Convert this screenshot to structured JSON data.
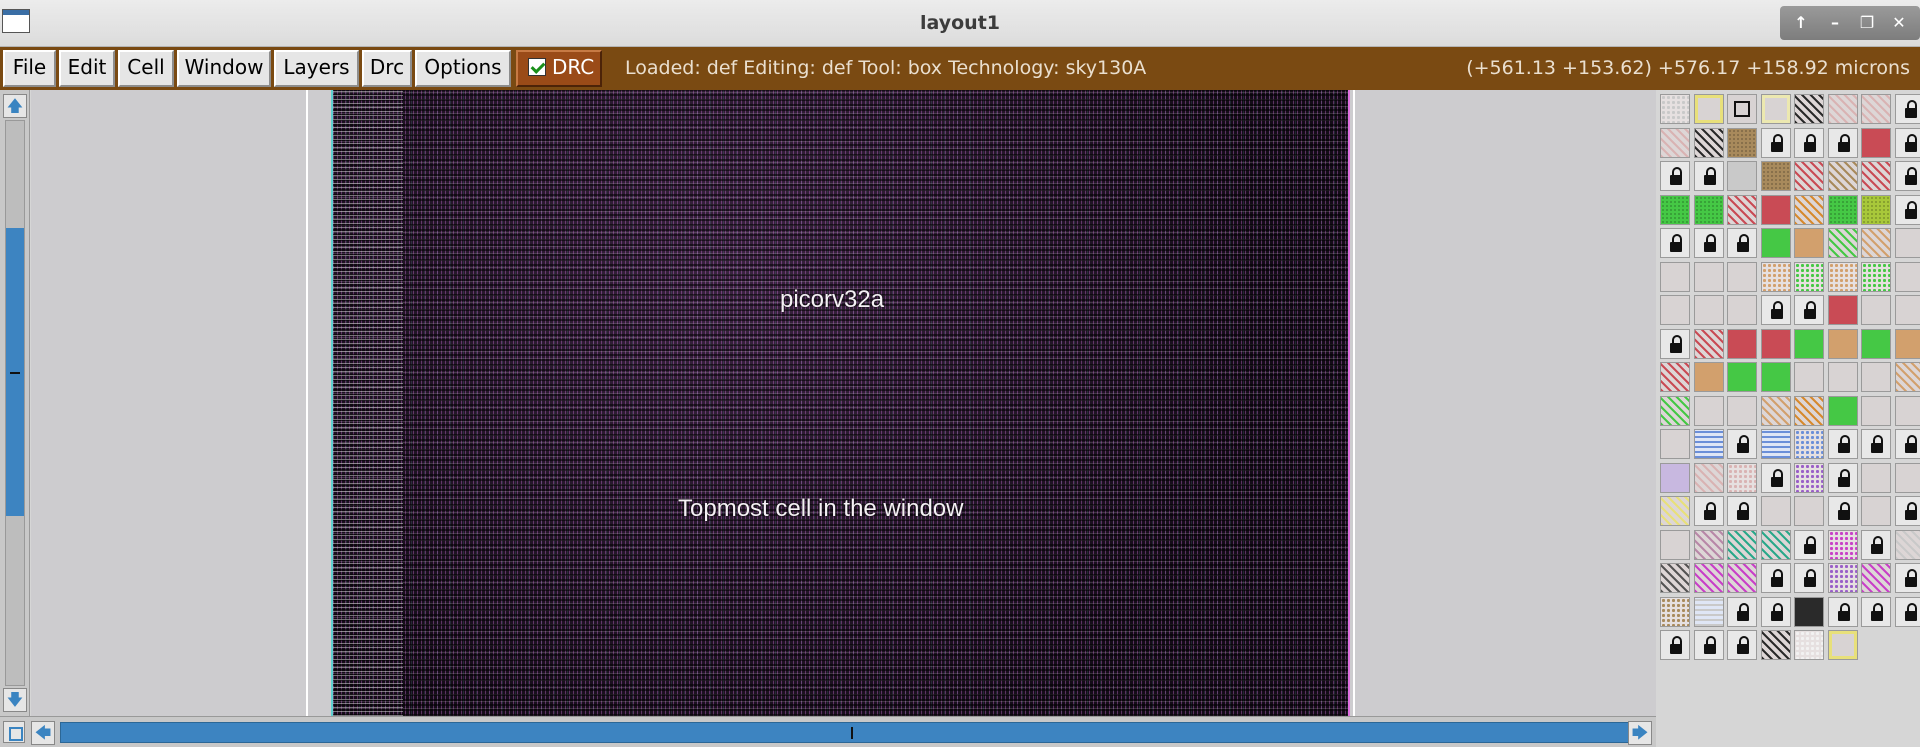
{
  "window": {
    "title": "layout1",
    "controls": {
      "up": "↑",
      "minimize": "–",
      "maximize": "❐",
      "close": "✕"
    }
  },
  "menu": [
    "File",
    "Edit",
    "Cell",
    "Window",
    "Layers",
    "Drc",
    "Options"
  ],
  "drc_toggle": {
    "label": "DRC",
    "checked": true
  },
  "status": {
    "left": "Loaded: def Editing: def Tool: box  Technology: sky130A",
    "right": "(+561.13 +153.62) +576.17 +158.92 microns"
  },
  "canvas": {
    "cell_name": "picorv32a",
    "cell_description": "Topmost cell in the window"
  },
  "scrollbars": {
    "vertical": {
      "thumb_start": 0.19,
      "thumb_end": 0.7,
      "arrow_up": "🡅",
      "arrow_down": "🡇"
    },
    "horizontal": {
      "thumb_start": 0.0,
      "thumb_end": 1.0,
      "arrow_left": "🡄",
      "arrow_right": "🡆"
    }
  },
  "layer_palette": {
    "rows": [
      [
        "dots-gray",
        "empty-yellow",
        "box-outline-black",
        "empty-yellow-light",
        "hatch-black",
        "hatch-pink",
        "hatch-pink",
        "lock"
      ],
      [
        "hatch-pink",
        "hatch-black",
        "stipple-brown",
        "lock",
        "lock",
        "lock",
        "solid-red",
        "lock"
      ],
      [
        "lock",
        "lock",
        "solid-gray",
        "stipple-brown",
        "hatch-red",
        "hatch-brown",
        "hatch-red",
        "lock"
      ],
      [
        "stipple-green",
        "stipple-green",
        "hatch-red",
        "solid-red",
        "hatch-orange",
        "stipple-green",
        "stipple-yellowgreen",
        "lock"
      ],
      [
        "lock",
        "lock",
        "lock",
        "solid-green",
        "solid-tan",
        "hatch-green",
        "hatch-tan",
        "cross-teal"
      ],
      [
        "cross-blue",
        "cross-teal",
        "cross-blue",
        "dots-tan",
        "dots-green",
        "dots-tan",
        "dots-green",
        "cross-blue"
      ],
      [
        "cross-blue",
        "cross-blue",
        "cross-blue",
        "lock",
        "lock",
        "solid-red",
        "cross-purple",
        "cross-purple"
      ],
      [
        "lock",
        "hatch-red",
        "solid-red",
        "solid-red",
        "solid-green",
        "solid-tan",
        "solid-green",
        "solid-tan"
      ],
      [
        "hatch-red",
        "solid-tan",
        "solid-green",
        "solid-green",
        "cross-blue",
        "cross-teal",
        "cross-teal",
        "hatch-tan"
      ],
      [
        "hatch-green",
        "cross-blue",
        "cross-teal",
        "hatch-tan",
        "hatch-orange",
        "solid-green",
        "cross-blue",
        "cross-tan"
      ],
      [
        "cross-teal",
        "wave-blue",
        "lock",
        "wave-blue",
        "dots-blue",
        "lock",
        "lock",
        "lock"
      ],
      [
        "solid-lavender",
        "hatch-pink",
        "dots-pink",
        "lock",
        "dots-purple",
        "lock",
        "cross-pink",
        "cross-pink"
      ],
      [
        "hatch-yellow",
        "lock",
        "lock",
        "cross-gray",
        "cross-gray",
        "lock",
        "cross-teal-dark",
        "lock"
      ],
      [
        "cross-pink",
        "hatch-mauve",
        "hatch-teal",
        "hatch-teal",
        "lock",
        "dots-magenta",
        "lock",
        "hatch-gray"
      ],
      [
        "hatch-dark",
        "hatch-magenta",
        "hatch-magenta",
        "lock",
        "lock",
        "dots-purple",
        "hatch-magenta",
        "lock"
      ],
      [
        "dots-brown",
        "wave-gray",
        "lock",
        "lock",
        "solid-black",
        "lock",
        "lock",
        "lock"
      ],
      [
        "lock",
        "lock",
        "lock",
        "hatch-black",
        "dots-white",
        "empty-yellow"
      ]
    ]
  },
  "colors": {
    "toolbar_bg": "#7a4a12",
    "scroll_accent": "#3d84c1",
    "canvas_bg": "#cdcccf"
  }
}
